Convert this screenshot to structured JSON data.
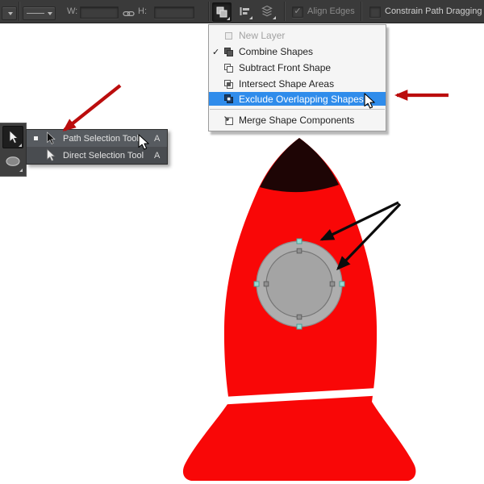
{
  "options_bar": {
    "w_label": "W:",
    "w_value": "",
    "h_label": "H:",
    "h_value": "",
    "check_glyph": "✓",
    "align_edges_label": "Align Edges",
    "constrain_label": "Constrain Path Dragging"
  },
  "path_ops_menu": {
    "check_glyph": "✓",
    "items": [
      {
        "label": "New Layer",
        "state": "disabled"
      },
      {
        "label": "Combine Shapes",
        "state": "checked"
      },
      {
        "label": "Subtract Front Shape",
        "state": "normal"
      },
      {
        "label": "Intersect Shape Areas",
        "state": "normal"
      },
      {
        "label": "Exclude Overlapping Shapes",
        "state": "highlighted"
      },
      {
        "label": "Merge Shape Components",
        "state": "normal"
      }
    ]
  },
  "tool_flyout": {
    "items": [
      {
        "label": "Path Selection Tool",
        "shortcut": "A",
        "selected": true
      },
      {
        "label": "Direct Selection Tool",
        "shortcut": "A",
        "selected": false
      }
    ]
  },
  "colors": {
    "highlight_blue": "#2f8ceb",
    "rocket_red": "#f90707",
    "nose_cone": "#1e0505",
    "window_gray": "#aeaeae",
    "window_inner_gray": "#a4a4a4",
    "anchor_selected_cyan": "#98d9d1",
    "anchor_gray": "#909090",
    "annotation_red": "#bb0d0d",
    "annotation_black": "#0c0c0c"
  }
}
